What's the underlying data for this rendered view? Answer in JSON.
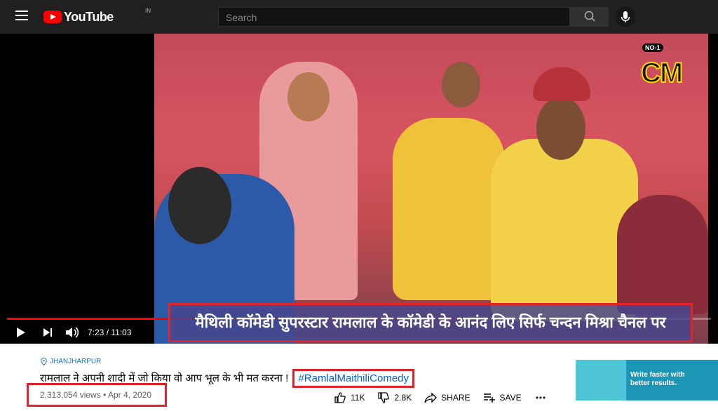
{
  "header": {
    "logo_text": "YouTube",
    "country_code": "IN",
    "search_placeholder": "Search"
  },
  "player": {
    "current_time": "7:23",
    "duration": "11:03",
    "time_display": "7:23 / 11:03",
    "progress": 0.668,
    "channel_logo_badge": "NO-1",
    "channel_logo_text": "CM",
    "caption": "मैथिली कॉमेडी सुपरस्टार रामलाल के कॉमेडी के आनंद लिए सिर्फ चन्दन मिश्रा चैनल पर"
  },
  "video": {
    "location": "JHANJHARPUR",
    "title": "रामलाल ने अपनी शादी में जो किया वो आप भूल के भी मत करना !",
    "hashtag": "#RamlalMaithiliComedy",
    "views": "2,313,054 views",
    "date": "Apr 4, 2020"
  },
  "actions": {
    "likes": "11K",
    "dislikes": "2.8K",
    "share_label": "SHARE",
    "save_label": "SAVE"
  },
  "ad": {
    "line1": "Write faster with",
    "line2": "better results."
  },
  "colors": {
    "brand_red": "#ff0000",
    "highlight_red": "#e3232b",
    "link_blue": "#065fd4"
  }
}
